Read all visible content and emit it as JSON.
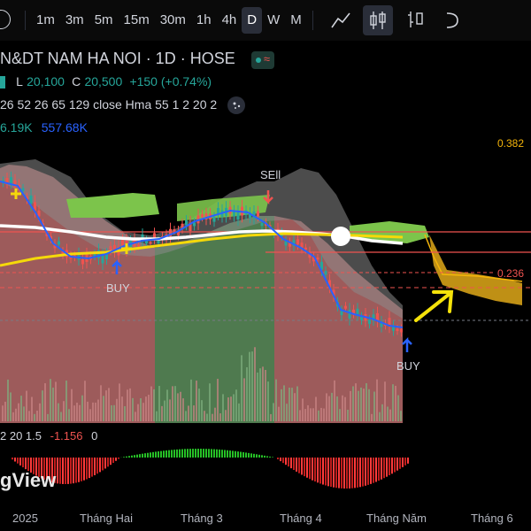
{
  "toolbar": {
    "timeframes": [
      "1m",
      "3m",
      "5m",
      "15m",
      "30m",
      "1h",
      "4h",
      "D",
      "W",
      "M"
    ],
    "active_timeframe": "D",
    "chart_style_icons": [
      "line-chart-icon",
      "candles-icon",
      "bars-icon",
      "more-icon"
    ]
  },
  "symbol": {
    "title": "N&DT NAM HA NOI · 1D · HOSE",
    "ohlc_low_label": "L",
    "ohlc_low": "20,100",
    "ohlc_close_label": "C",
    "ohlc_close": "20,500",
    "change": "+150 (+0.74%)"
  },
  "indicator": {
    "params": "26 52 26 65 129 close Hma 55 1 2 20 2"
  },
  "volume": {
    "v1": "6.19K",
    "v2": "557.68K"
  },
  "price_scale": {
    "fib_382": "0.382",
    "fib_236": "0.236"
  },
  "signals": {
    "sell": "SEll",
    "buy1": "BUY",
    "buy2": "BUY"
  },
  "macd": {
    "params": "2 20 1.5",
    "value": "-1.156",
    "extra": "0"
  },
  "logo": {
    "text": "gView"
  },
  "xaxis": {
    "labels": [
      "2025",
      "Tháng Hai",
      "Tháng 3",
      "Tháng 4",
      "Tháng Năm",
      "Tháng 6"
    ]
  },
  "colors": {
    "up": "#26a69a",
    "down": "#ef5350",
    "cloud_green": "#7cc44b",
    "cloud_orange": "#d4a017",
    "red_zone": "#e88f8f",
    "green_zone": "#8bc58b",
    "ma_yellow": "#f5d90a",
    "ma_white": "#ffffff",
    "hma_blue": "#2962ff"
  }
}
